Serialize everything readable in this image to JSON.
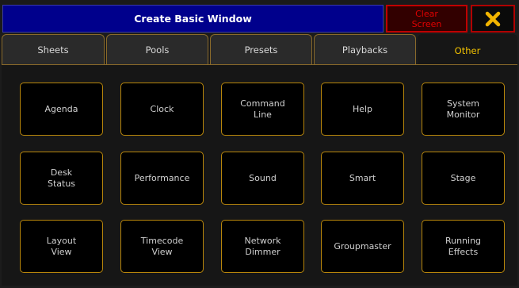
{
  "window": {
    "title": "Create Basic Window",
    "clear_label_line1": "Clear",
    "clear_label_line2": "Screen"
  },
  "tabs": [
    {
      "label": "Sheets",
      "active": false
    },
    {
      "label": "Pools",
      "active": false
    },
    {
      "label": "Presets",
      "active": false
    },
    {
      "label": "Playbacks",
      "active": false
    },
    {
      "label": "Other",
      "active": true
    }
  ],
  "grid": [
    [
      "Agenda",
      "Clock",
      "Command\nLine",
      "Help",
      "System\nMonitor"
    ],
    [
      "Desk\nStatus",
      "Performance",
      "Sound",
      "Smart",
      "Stage"
    ],
    [
      "Layout\nView",
      "Timecode\nView",
      "Network\nDimmer",
      "Groupmaster",
      "Running\nEffects"
    ]
  ],
  "colors": {
    "title_bg": "#00008c",
    "accent_border": "#b8860b",
    "active_tab_text": "#f2c200",
    "clear_red": "#e00000",
    "close_icon": "#f2b400"
  },
  "icons": {
    "close": "close-x-icon"
  }
}
